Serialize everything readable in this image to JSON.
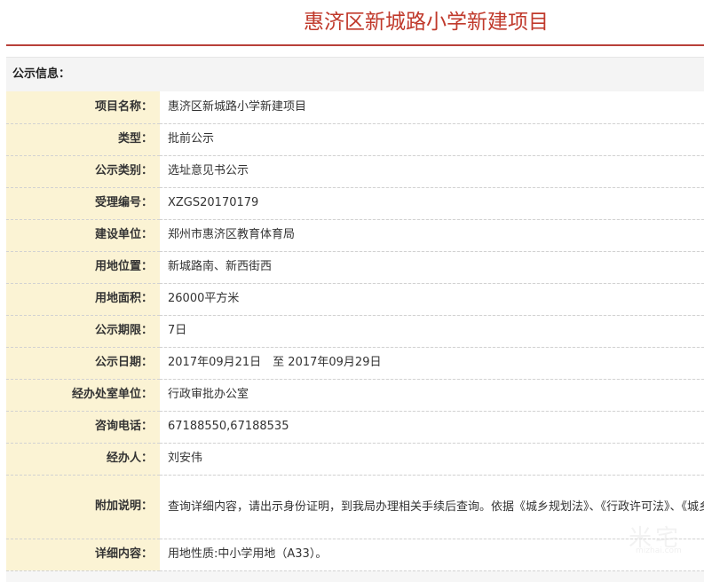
{
  "page": {
    "title": "惠济区新城路小学新建项目"
  },
  "section": {
    "title": "公示信息："
  },
  "rows": [
    {
      "label": "项目名称：",
      "value": "惠济区新城路小学新建项目"
    },
    {
      "label": "类型：",
      "value": "批前公示"
    },
    {
      "label": "公示类别：",
      "value": "选址意见书公示"
    },
    {
      "label": "受理编号：",
      "value": "XZGS20170179"
    },
    {
      "label": "建设单位：",
      "value": "郑州市惠济区教育体育局"
    },
    {
      "label": "用地位置：",
      "value": "新城路南、新西街西"
    },
    {
      "label": "用地面积：",
      "value": "26000平方米"
    },
    {
      "label": "公示期限：",
      "value": "7日"
    },
    {
      "label": "公示日期：",
      "value": "2017年09月21日　至 2017年09月29日"
    },
    {
      "label": "经办处室单位：",
      "value": "行政审批办公室"
    },
    {
      "label": "咨询电话：",
      "value": "67188550,67188535"
    },
    {
      "label": "经办人：",
      "value": "刘安伟"
    },
    {
      "label": "附加说明：",
      "value": "查询详细内容，请出示身份证明，到我局办理相关手续后查询。依据《城乡规划法》、《行政许可法》、《城乡规划公示制度》等有关法律法规，特此公示。如有意见和建议，请于公示时间内向我局反馈。 信访处电话：67188539。"
    },
    {
      "label": "详细内容：",
      "value": "用地性质:中小学用地（A33）。"
    }
  ],
  "watermark": {
    "text_cn": "米宅",
    "text_en": "mizhai.com"
  },
  "colors": {
    "title": "#c0392b",
    "rule": "#b8403a",
    "label_bg": "#fbf3d4"
  }
}
